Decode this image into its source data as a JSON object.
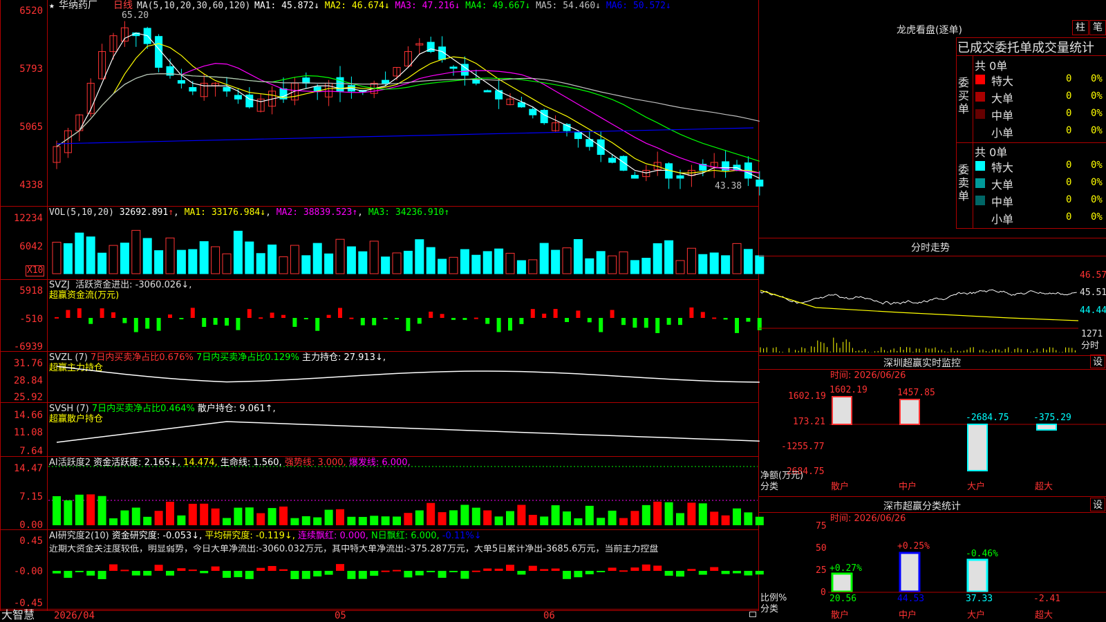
{
  "header": {
    "stock_name": "华纳药厂",
    "period": "日线",
    "ma_label": "MA(5,10,20,30,60,120)",
    "ma": [
      {
        "name": "MA1",
        "value": "45.872↓",
        "color": "#ffffff"
      },
      {
        "name": "MA2",
        "value": "46.674↓",
        "color": "#ffff00"
      },
      {
        "name": "MA3",
        "value": "47.216↓",
        "color": "#ff00ff"
      },
      {
        "name": "MA4",
        "value": "49.667↓",
        "color": "#00ff00"
      },
      {
        "name": "MA5",
        "value": "54.460↓",
        "color": "#c0c0c0"
      },
      {
        "name": "MA6",
        "value": "50.572↓",
        "color": "#0000ff"
      }
    ],
    "high_mark": "65.20",
    "low_mark": "43.38"
  },
  "price_axis": [
    "6520",
    "5793",
    "5065",
    "4338"
  ],
  "volume": {
    "label": "VOL(5,10,20)",
    "value": "32692.891",
    "ma1": "MA1: 33176.984↓",
    "ma2": "MA2: 38839.523↑",
    "ma3": "MA3: 34236.910↑",
    "axis": [
      "12234",
      "6042"
    ],
    "unit": "X10"
  },
  "svzj": {
    "name": "SVZJ",
    "text": "活跃资金进出: -3060.026↓,",
    "sub": "超赢资金流(万元)",
    "axis": [
      "5918",
      "-510",
      "-6939"
    ]
  },
  "svzl": {
    "name": "SVZL (7)",
    "t1": "7日内买卖净占比0.676%",
    "t2": "7日内买卖净占比0.129%",
    "t3": "主力持仓: 27.913↓,",
    "sub": "超赢主力持仓",
    "axis": [
      "31.76",
      "28.84",
      "25.92"
    ]
  },
  "svsh": {
    "name": "SVSH (7)",
    "t1": "7日内买卖净占比0.464%",
    "t2": "散户持仓: 9.061↑,",
    "sub": "超赢散户持仓",
    "axis": [
      "14.66",
      "11.08",
      "7.64"
    ]
  },
  "ai1": {
    "name": "AI活跃度2",
    "t1": "资金活跃度: 2.165↓,",
    "t2": "14.474,",
    "t3": "生命线: 1.560,",
    "t4": "强势线: 3.000,",
    "t5": "爆发线: 6.000,",
    "axis": [
      "14.47",
      "7.15",
      "0.00"
    ]
  },
  "ai2": {
    "name": "AI研究度2(10)",
    "t1": "资金研究度: -0.053↓,",
    "t2": "平均研究度: -0.119↓,",
    "t3": "连续飘红: 0.000,",
    "t4": "N日飘红: 6.000,",
    "t5": "-0.11%↓",
    "note": "近期大资金关注度较低，明显弱势，今日大单净流出:-3060.032万元，其中特大单净流出:-375.287万元，大单5日累计净出-3685.6万元，当前主力控盘",
    "axis": [
      "0.45",
      "-0.00",
      "-0.45"
    ]
  },
  "bottom": {
    "brand": "大智慧",
    "date1": "2026/04",
    "m05": "05",
    "m06": "06"
  },
  "right": {
    "title": "龙虎看盘(逐单)",
    "btn1": "柱",
    "btn2": "笔",
    "table_title": "已成交委托单成交量统计",
    "buy_label": "委买单",
    "sell_label": "委卖单",
    "buy_total": "共 0单",
    "sell_total": "共 0单",
    "buy_rows": [
      {
        "name": "特大",
        "count": "0",
        "pct": "0%",
        "color": "#ff0000"
      },
      {
        "name": "大单",
        "count": "0",
        "pct": "0%",
        "color": "#aa0000"
      },
      {
        "name": "中单",
        "count": "0",
        "pct": "0%",
        "color": "#660000"
      },
      {
        "name": "小单",
        "count": "0",
        "pct": "0%",
        "color": ""
      }
    ],
    "sell_rows": [
      {
        "name": "特大",
        "count": "0",
        "pct": "0%",
        "color": "#00ffff"
      },
      {
        "name": "大单",
        "count": "0",
        "pct": "0%",
        "color": "#009999"
      },
      {
        "name": "中单",
        "count": "0",
        "pct": "0%",
        "color": "#006666"
      },
      {
        "name": "小单",
        "count": "0",
        "pct": "0%",
        "color": ""
      }
    ],
    "intraday_title": "分时走势",
    "intraday_axis": [
      "46.57",
      "45.51",
      "44.44",
      "1271",
      "分时"
    ],
    "monitor_title": "深圳超赢实时监控",
    "set_label": "设",
    "time_label": "时间: 2026/06/26",
    "monitor_axis": [
      "1602.19",
      "173.21",
      "-1255.77",
      "-2684.75"
    ],
    "monitor_ylabel": "净额(万元)",
    "monitor_xlabel": "分类",
    "monitor_bars": [
      {
        "cat": "散户",
        "value": "1602.19"
      },
      {
        "cat": "中户",
        "value": "1457.85"
      },
      {
        "cat": "大户",
        "value": "-2684.75"
      },
      {
        "cat": "超大",
        "value": "-375.29"
      }
    ],
    "stat_title": "深市超赢分类统计",
    "stat_time": "时间: 2026/06/26",
    "stat_axis": [
      "75",
      "50",
      "25",
      "0"
    ],
    "stat_ylabel": "比例%",
    "stat_xlabel": "分类",
    "stat_bars": [
      {
        "cat": "散户",
        "value": "20.56",
        "change": "+0.27%"
      },
      {
        "cat": "中户",
        "value": "44.53",
        "change": "+0.25%"
      },
      {
        "cat": "大户",
        "value": "37.33",
        "change": "-0.46%"
      },
      {
        "cat": "超大",
        "value": "-2.41",
        "change": ""
      }
    ]
  }
}
